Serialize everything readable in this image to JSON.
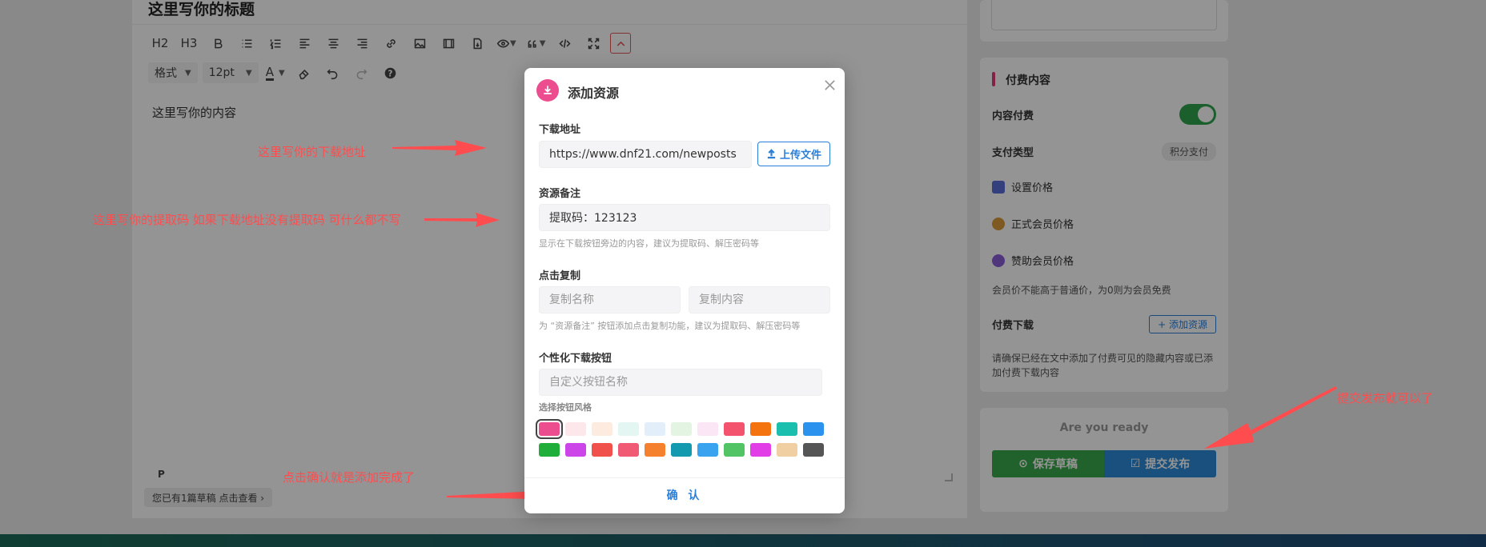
{
  "editor": {
    "title": "这里写你的标题",
    "toolbar_row1": [
      "H2",
      "H3"
    ],
    "format_select": "格式",
    "size_select": "12pt",
    "font_color_label": "A",
    "content": "这里写你的内容",
    "status_tag": "P",
    "draft_notice": "您已有1篇草稿 点击查看 ›"
  },
  "sidebar": {
    "paid_title": "付费内容",
    "paid_content_label": "内容付费",
    "pay_type_label": "支付类型",
    "pay_type_value": "积分支付",
    "set_price": "设置价格",
    "vip_price": "正式会员价格",
    "sponsor_price": "赞助会员价格",
    "member_note": "会员价不能高于普通价，为0则为会员免费",
    "paid_download_label": "付费下载",
    "add_resource_btn": "+ 添加资源",
    "paid_note": "请确保已经在文中添加了付费可见的隐藏内容或已添加付费下载内容",
    "ready_text": "Are you ready",
    "save_draft": "保存草稿",
    "submit": "提交发布"
  },
  "modal": {
    "title": "添加资源",
    "download_label": "下载地址",
    "download_value": "https://www.dnf21.com/newposts",
    "upload_btn": "上传文件",
    "note_label": "资源备注",
    "note_value": "提取码：123123",
    "note_hint": "显示在下载按钮旁边的内容，建议为提取码、解压密码等",
    "copy_label": "点击复制",
    "copy_name_placeholder": "复制名称",
    "copy_content_placeholder": "复制内容",
    "copy_hint": "为 “资源备注” 按钮添加点击复制功能，建议为提取码、解压密码等",
    "custom_btn_label": "个性化下载按钮",
    "custom_btn_placeholder": "自定义按钮名称",
    "style_label": "选择按钮风格",
    "confirm": "确 认",
    "swatches_row1": [
      "#ec4d8e",
      "#fde7ea",
      "#fdebe0",
      "#e3f6f2",
      "#e2effb",
      "#e3f4e2",
      "#fbe6f6",
      "#f4536e",
      "#f5730f",
      "#1abfae",
      "#2b93ee"
    ],
    "swatches_row2": [
      "#1fae3a",
      "#cb45e8",
      "#f0514a",
      "#f05a74",
      "#f5812f",
      "#139aae",
      "#3aa3f0",
      "#53c466",
      "#e23ee8",
      "#f0cfa2",
      "#555555"
    ]
  },
  "annotations": {
    "download_address": "这里写你的下载地址",
    "extract_code": "这里写你的提取码  如果下载地址没有提取码  可什么都不写",
    "confirm_note": "点击确认就是添加完成了",
    "submit_note": "提交发布就可以了"
  },
  "colors": {
    "accent": "#2b7fd8",
    "pink": "#ec4d8e",
    "annotation": "#ff4d4f",
    "green": "#3aa84a"
  }
}
